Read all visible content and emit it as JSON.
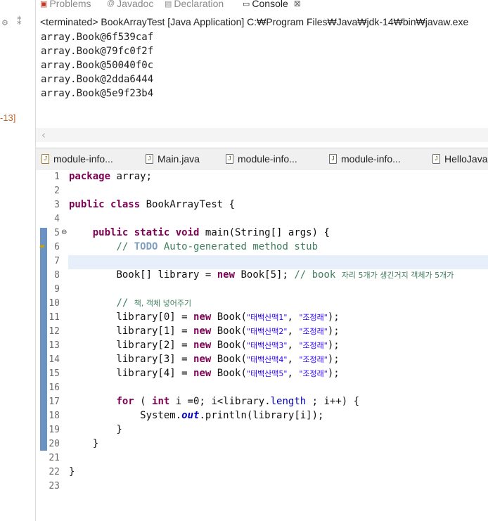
{
  "left_strip": {
    "icon_a": "gear-icon",
    "icon_b": "settings-icon",
    "coord_text": "-13]"
  },
  "console_view": {
    "tabs": [
      {
        "label": "Problems",
        "icon": "problems-icon"
      },
      {
        "label": "Javadoc",
        "icon": "at-icon"
      },
      {
        "label": "Declaration",
        "icon": "declaration-icon"
      },
      {
        "label": "Console",
        "icon": "console-icon",
        "close": "⊠",
        "active": true
      }
    ],
    "header": "<terminated> BookArrayTest [Java Application] C:₩Program Files₩Java₩jdk-14₩bin₩javaw.exe",
    "lines": [
      "array.Book@6f539caf",
      "array.Book@79fc0f2f",
      "array.Book@50040f0c",
      "array.Book@2dda6444",
      "array.Book@5e9f23b4"
    ],
    "scroll_arrow": "‹"
  },
  "editor_tabs": [
    {
      "label": "module-info...",
      "icon": "module-icon"
    },
    {
      "label": "Main.java",
      "icon": "java-file-icon"
    },
    {
      "label": "module-info...",
      "icon": "java-file-icon"
    },
    {
      "label": "module-info...",
      "icon": "java-file-icon"
    },
    {
      "label": "HelloJava",
      "icon": "java-file-icon"
    }
  ],
  "editor": {
    "line_numbers": [
      "1",
      "2",
      "3",
      "4",
      "5",
      "6",
      "7",
      "8",
      "9",
      "10",
      "11",
      "12",
      "13",
      "14",
      "15",
      "16",
      "17",
      "18",
      "19",
      "20",
      "21",
      "22",
      "23"
    ],
    "fold_marker": "⊖",
    "code": {
      "l1_kw": "package",
      "l1_rest": " array;",
      "l3_kw1": "public",
      "l3_kw2": "class",
      "l3_rest": " BookArrayTest {",
      "l5_indent": "    ",
      "l5_kw1": "public",
      "l5_kw2": "static",
      "l5_kw3": "void",
      "l5_rest": " main(String[] args) {",
      "l6_indent": "        ",
      "l6_cm1": "// ",
      "l6_todo": "TODO",
      "l6_cm2": " Auto-generated method stub",
      "l8_indent": "        ",
      "l8_a": "Book[] library = ",
      "l8_kw": "new",
      "l8_b": " Book[5]; ",
      "l8_cm": "// book ",
      "l8_cm_kr": "자리 5개가 생긴거지 객체가 5개가",
      "l10_indent": "        ",
      "l10_cm": "// ",
      "l10_cm_kr": "책, 객체 넣어주기",
      "rows": [
        {
          "a": "        library[0] = ",
          "kw": "new",
          "b": " Book(",
          "s1": "\"태백산맥1\"",
          "c": ", ",
          "s2": "\"조정래\"",
          "d": ");"
        },
        {
          "a": "        library[1] = ",
          "kw": "new",
          "b": " Book(",
          "s1": "\"태백산맥2\"",
          "c": ", ",
          "s2": "\"조정래\"",
          "d": ");"
        },
        {
          "a": "        library[2] = ",
          "kw": "new",
          "b": " Book(",
          "s1": "\"태백산맥3\"",
          "c": ", ",
          "s2": "\"조정래\"",
          "d": ");"
        },
        {
          "a": "        library[3] = ",
          "kw": "new",
          "b": " Book(",
          "s1": "\"태백산맥4\"",
          "c": ", ",
          "s2": "\"조정래\"",
          "d": ");"
        },
        {
          "a": "        library[4] = ",
          "kw": "new",
          "b": " Book(",
          "s1": "\"태백산맥5\"",
          "c": ", ",
          "s2": "\"조정래\"",
          "d": ");"
        }
      ],
      "l17_indent": "        ",
      "l17_kw1": "for",
      "l17_a": " ( ",
      "l17_kw2": "int",
      "l17_b": " i =0; i<library.",
      "l17_fd": "length",
      "l17_c": " ; i++) {",
      "l18_indent": "            ",
      "l18_a": "System.",
      "l18_fd": "out",
      "l18_b": ".println(library[i]);",
      "l19": "        }",
      "l20": "    }",
      "l22": "}"
    }
  }
}
